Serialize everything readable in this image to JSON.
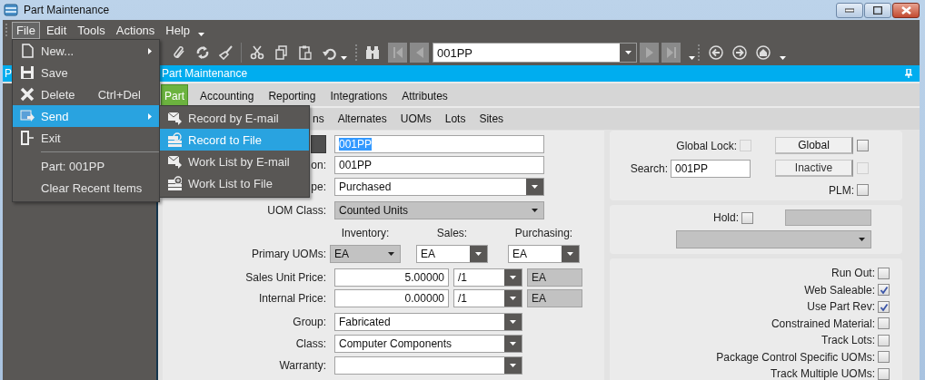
{
  "window": {
    "title": "Part Maintenance"
  },
  "menu_bar": [
    {
      "label": "File",
      "selected": true
    },
    {
      "label": "Edit",
      "selected": false
    },
    {
      "label": "Tools",
      "selected": false
    },
    {
      "label": "Actions",
      "selected": false
    },
    {
      "label": "Help",
      "selected": false
    }
  ],
  "file_menu": [
    {
      "kind": "item",
      "label": "New...",
      "submenu": true,
      "selected": false
    },
    {
      "kind": "item",
      "label": "Save",
      "selected": false
    },
    {
      "kind": "item",
      "label": "Delete",
      "shortcut": "Ctrl+Del",
      "selected": false
    },
    {
      "kind": "item",
      "label": "Send",
      "submenu": true,
      "selected": true
    },
    {
      "kind": "item",
      "label": "Exit",
      "selected": false
    },
    {
      "kind": "separator"
    },
    {
      "kind": "recent",
      "label": "Part: 001PP",
      "selected": false
    },
    {
      "kind": "recent",
      "label": "Clear Recent Items",
      "selected": false
    }
  ],
  "send_submenu": [
    {
      "label": "Record by E-mail",
      "selected": false
    },
    {
      "label": "Record to File",
      "selected": true
    },
    {
      "label": "Work List by E-mail",
      "selected": false
    },
    {
      "label": "Work List to File",
      "selected": false
    }
  ],
  "toolbar": {
    "record_value": "001PP"
  },
  "panel_header": {
    "left_title": "P",
    "title": "Part Maintenance"
  },
  "tabs": [
    {
      "label": "Part",
      "selected": true
    },
    {
      "label": "Accounting",
      "selected": false
    },
    {
      "label": "Reporting",
      "selected": false
    },
    {
      "label": "Integrations",
      "selected": false
    },
    {
      "label": "Attributes",
      "selected": false
    }
  ],
  "sub_tabs": [
    {
      "label": "ns"
    },
    {
      "label": "Alternates"
    },
    {
      "label": "UOMs"
    },
    {
      "label": "Lots"
    },
    {
      "label": "Sites"
    }
  ],
  "part_fields": [
    {
      "kind": "text",
      "label_button": true,
      "value": "001PP",
      "text_selected": true
    },
    {
      "kind": "text",
      "label": "on:",
      "value": "001PP",
      "text_selected": false
    },
    {
      "kind": "combo",
      "label": "pe:",
      "value": "Purchased",
      "disabled": false
    },
    {
      "kind": "combo",
      "label": "UOM Class:",
      "value": "Counted Units",
      "disabled": true
    }
  ],
  "primary_uoms": {
    "label": "Primary UOMs:",
    "headers": [
      "Inventory:",
      "Sales:",
      "Purchasing:"
    ],
    "combos": [
      {
        "value": "EA",
        "disabled": true
      },
      {
        "value": "EA",
        "disabled": false
      },
      {
        "value": "EA",
        "disabled": false
      }
    ]
  },
  "prices": [
    {
      "label": "Sales Unit Price:",
      "amount": "5.00000",
      "per": "/1",
      "uom": "EA"
    },
    {
      "label": "Internal Price:",
      "amount": "0.00000",
      "per": "/1",
      "uom": "EA"
    }
  ],
  "more_fields": [
    {
      "label": "Group:",
      "value": "Fabricated"
    },
    {
      "label": "Class:",
      "value": "Computer Components"
    },
    {
      "label": "Warranty:"
    }
  ],
  "global_panel": {
    "global_lock": {
      "label": "Global Lock:",
      "checked": false,
      "disabled": true
    },
    "search": {
      "label": "Search:",
      "value": "001PP"
    },
    "buttons": [
      {
        "label": "Global",
        "checked": false,
        "disabled": false
      },
      {
        "label": "Inactive",
        "checked": false,
        "disabled": true
      }
    ],
    "plm": {
      "label": "PLM:",
      "checked": false
    }
  },
  "hold_panel": {
    "label": "Hold:",
    "checked": false
  },
  "flags": [
    {
      "label": "Run Out:",
      "checked": false
    },
    {
      "label": "Web Saleable:",
      "checked": true
    },
    {
      "label": "Use Part Rev:",
      "checked": true
    },
    {
      "label": "Constrained Material:",
      "checked": false
    },
    {
      "label": "Track Lots:",
      "checked": false
    },
    {
      "label": "Package Control Specific UOMs:",
      "checked": false
    },
    {
      "label": "Track Multiple UOMs:",
      "checked": false
    }
  ]
}
